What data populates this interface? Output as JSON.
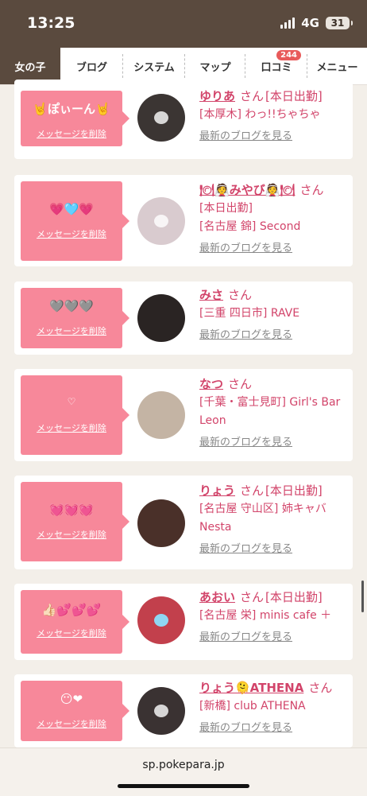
{
  "status": {
    "time": "13:25",
    "network": "4G",
    "battery": "31"
  },
  "nav": {
    "items": [
      {
        "label": "女の子",
        "active": true
      },
      {
        "label": "ブログ",
        "active": false
      },
      {
        "label": "システム",
        "active": false
      },
      {
        "label": "マップ",
        "active": false
      },
      {
        "label": "口コミ",
        "active": false,
        "badge": "244"
      },
      {
        "label": "メニュー",
        "active": false
      }
    ]
  },
  "delete_label": "メッセージを削除",
  "san_label": "さん",
  "blog_label": "最新のブログを見る",
  "cards": [
    {
      "message": "🤘ぽぃーん🤘",
      "name": "ゆりあ",
      "name_suffix": "[本日出勤]",
      "shop": "[本厚木] わっ!!ちゃちゃ",
      "avatar_color": "#3b3533"
    },
    {
      "message": "💗🩵💗",
      "name": "🍽👰みやび👰🍽",
      "name_suffix": "",
      "shop": "[本日出勤]",
      "shop2": "[名古屋 錦] Second",
      "avatar_color": "#d9cbcf"
    },
    {
      "message": "🩶🩶🩶",
      "name": "みさ",
      "name_suffix": "",
      "shop": "[三重 四日市] RAVE",
      "avatar_color": "#2a2423"
    },
    {
      "message": "♡",
      "name": "なつ",
      "name_suffix": "",
      "shop": "[千葉・富士見町] Girl's Bar Leon",
      "avatar_color": "#c4b4a4"
    },
    {
      "message": "💓💓💓",
      "name": "りょう",
      "name_suffix": "[本日出勤]",
      "shop": "[名古屋 守山区] 姉キャバ Nesta",
      "avatar_color": "#4a3029"
    },
    {
      "message": "👍🏻💕💕💕",
      "name": "あおい",
      "name_suffix": "[本日出勤]",
      "shop": "[名古屋 栄] minis cafe ＋",
      "avatar_color": "#c2404c"
    },
    {
      "message": "😶❤",
      "name": "りょう🫠ATHENA",
      "name_suffix": "",
      "shop": "[新橋] club ATHENA",
      "avatar_color": "#3a3232"
    }
  ],
  "browser": {
    "url": "sp.pokepara.jp"
  }
}
